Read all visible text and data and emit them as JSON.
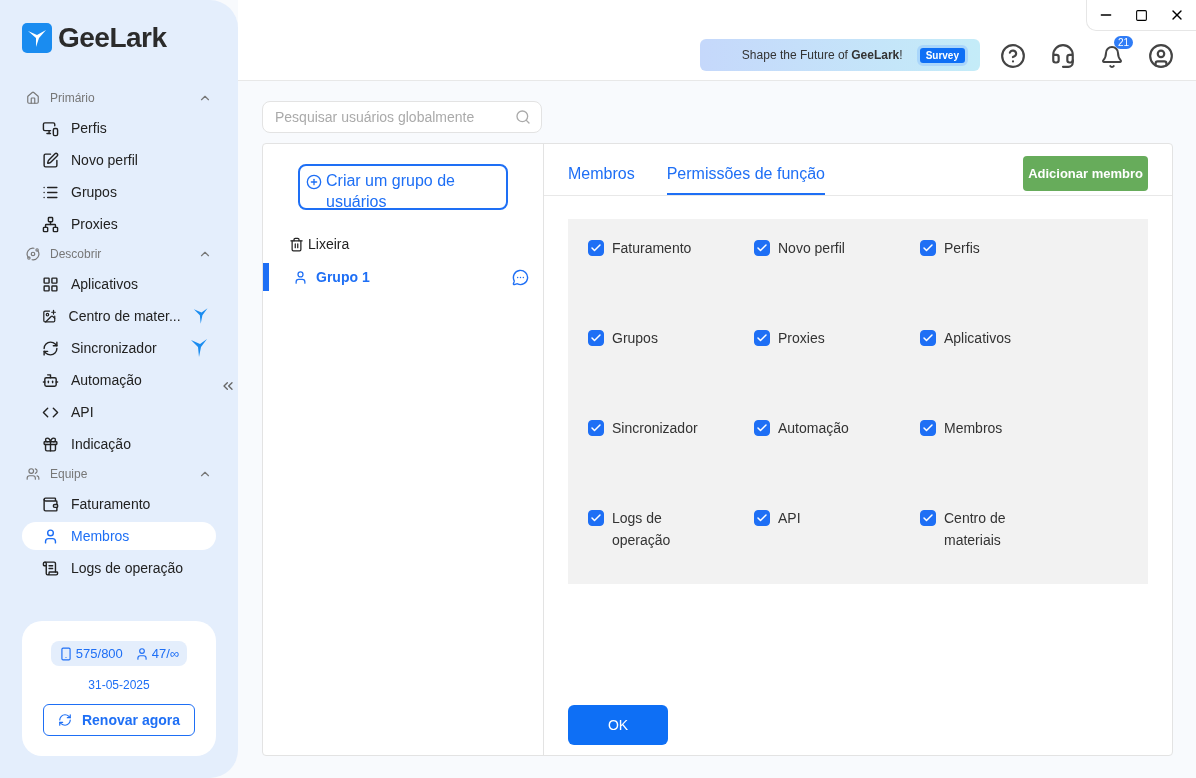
{
  "logo": {
    "text": "GeeLark"
  },
  "sidebar": {
    "sections": [
      {
        "label": "Primário",
        "expanded": true,
        "items": [
          {
            "label": "Perfis",
            "selected": false,
            "featured": false
          },
          {
            "label": "Novo perfil",
            "selected": false,
            "featured": false
          },
          {
            "label": "Grupos",
            "selected": false,
            "featured": false
          },
          {
            "label": "Proxies",
            "selected": false,
            "featured": false
          }
        ]
      },
      {
        "label": "Descobrir",
        "expanded": true,
        "items": [
          {
            "label": "Aplicativos",
            "selected": false,
            "featured": false
          },
          {
            "label": "Centro de mater...",
            "selected": false,
            "featured": true
          },
          {
            "label": "Sincronizador",
            "selected": false,
            "featured": true
          },
          {
            "label": "Automação",
            "selected": false,
            "featured": false
          },
          {
            "label": "API",
            "selected": false,
            "featured": false
          },
          {
            "label": "Indicação",
            "selected": false,
            "featured": false
          }
        ]
      },
      {
        "label": "Equipe",
        "expanded": true,
        "items": [
          {
            "label": "Faturamento",
            "selected": false,
            "featured": false
          },
          {
            "label": "Membros",
            "selected": true,
            "featured": false
          },
          {
            "label": "Logs de operação",
            "selected": false,
            "featured": false
          }
        ]
      }
    ],
    "plan": {
      "profiles": "575/800",
      "members": "47/∞",
      "date": "31-05-2025",
      "renew": "Renovar agora"
    }
  },
  "header": {
    "banner": {
      "text": "Shape the Future of **GeeLark**!",
      "button": "Survey"
    },
    "notifications": "21"
  },
  "search": {
    "placeholder": "Pesquisar usuários globalmente"
  },
  "groups": {
    "create": "Criar um grupo de usuários",
    "trash": "Lixeira",
    "items": [
      {
        "label": "Grupo 1",
        "selected": true
      }
    ]
  },
  "tabs": [
    {
      "label": "Membros",
      "selected": false
    },
    {
      "label": "Permissões de função",
      "selected": true
    }
  ],
  "add_button": "Adicionar membro",
  "permissions": [
    {
      "label": "Faturamento",
      "checked": true
    },
    {
      "label": "Novo perfil",
      "checked": true
    },
    {
      "label": "Perfis",
      "checked": true
    },
    {
      "label": "Grupos",
      "checked": true
    },
    {
      "label": "Proxies",
      "checked": true
    },
    {
      "label": "Aplicativos",
      "checked": true
    },
    {
      "label": "Sincronizador",
      "checked": true
    },
    {
      "label": "Automação",
      "checked": true
    },
    {
      "label": "Membros",
      "checked": true
    },
    {
      "label": "Logs de operação",
      "checked": true
    },
    {
      "label": "API",
      "checked": true
    },
    {
      "label": "Centro de materiais",
      "checked": true
    }
  ],
  "ok_button": "OK"
}
